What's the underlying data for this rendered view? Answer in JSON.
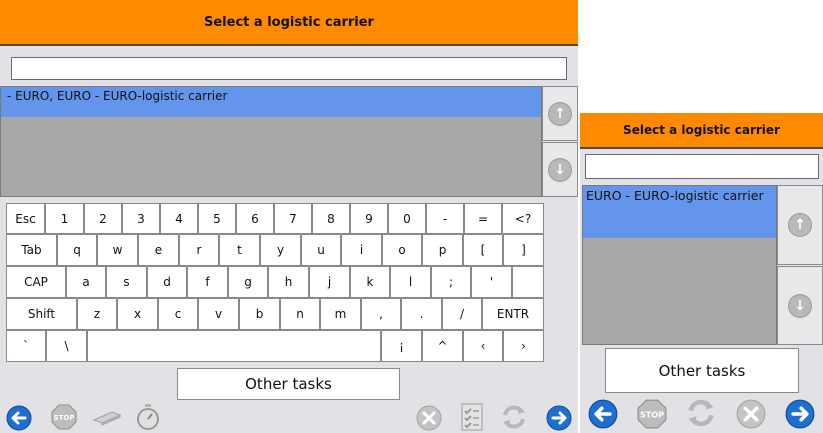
{
  "left": {
    "header_title": "Select a logistic carrier",
    "search_value": "",
    "list_items": [
      {
        "label": "- EURO, EURO - EURO-logistic carrier"
      }
    ],
    "other_tasks_label": "Other tasks"
  },
  "right": {
    "header_title": "Select a logistic carrier",
    "search_value": "",
    "list_items": [
      {
        "label": "EURO - EURO-logistic carrier"
      }
    ],
    "other_tasks_label": "Other tasks"
  },
  "keyboard": {
    "row1": [
      "Esc",
      "1",
      "2",
      "3",
      "4",
      "5",
      "6",
      "7",
      "8",
      "9",
      "0",
      "-",
      "=",
      "<?"
    ],
    "row2": [
      "Tab",
      "q",
      "w",
      "e",
      "r",
      "t",
      "y",
      "u",
      "i",
      "o",
      "p",
      "[",
      "]"
    ],
    "row3": [
      "CAP",
      "a",
      "s",
      "d",
      "f",
      "g",
      "h",
      "j",
      "k",
      "l",
      ";",
      "'",
      ""
    ],
    "row4": [
      "Shift",
      "z",
      "x",
      "c",
      "v",
      "b",
      "n",
      "m",
      ",",
      ".",
      "/",
      "ENTR"
    ],
    "row5": [
      "`",
      "\\",
      "",
      "¡",
      "^",
      "‹",
      "›"
    ]
  },
  "toolbar_icons": {
    "back": "left-arrow-icon",
    "stop": "stop-icon",
    "scanner": "scanner-icon",
    "timer": "stopwatch-icon",
    "cancel": "cancel-icon",
    "checklist": "checklist-icon",
    "refresh": "refresh-icon",
    "forward": "right-arrow-icon"
  },
  "stop_label": "STOP",
  "colors": {
    "header": "#ff8a00",
    "selected_row": "#6495ed",
    "nav_blue": "#1f6fd1"
  }
}
